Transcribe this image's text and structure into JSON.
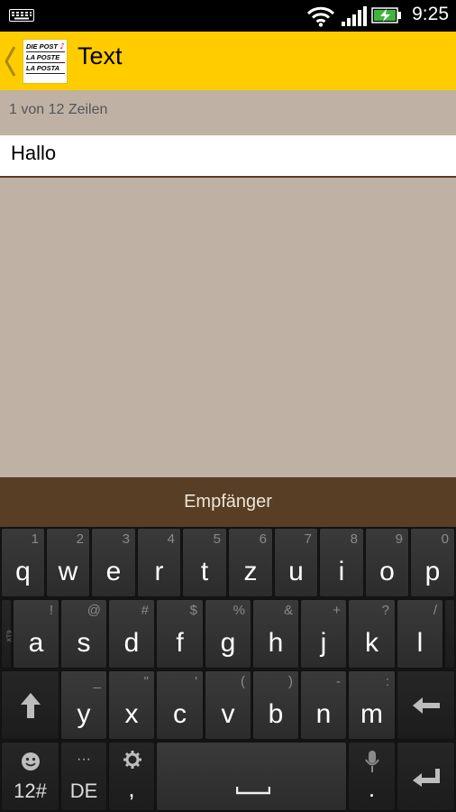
{
  "status_bar": {
    "time": "9:25",
    "icons": [
      "keyboard-icon",
      "wifi-icon",
      "signal-icon",
      "battery-charging-icon"
    ]
  },
  "action_bar": {
    "title": "Text",
    "logo_lines": [
      "DIE POST",
      "LA POSTE",
      "LA POSTA"
    ],
    "brand_color": "#ffcc00"
  },
  "editor": {
    "counter": "1 von 12 Zeilen",
    "line_value": "Hallo"
  },
  "recipient_button": {
    "label": "Empfänger"
  },
  "keyboard": {
    "row1": [
      {
        "key": "q",
        "hint": "1"
      },
      {
        "key": "w",
        "hint": "2"
      },
      {
        "key": "e",
        "hint": "3"
      },
      {
        "key": "r",
        "hint": "4"
      },
      {
        "key": "t",
        "hint": "5"
      },
      {
        "key": "z",
        "hint": "6"
      },
      {
        "key": "u",
        "hint": "7"
      },
      {
        "key": "i",
        "hint": "8"
      },
      {
        "key": "o",
        "hint": "9"
      },
      {
        "key": "p",
        "hint": "0"
      }
    ],
    "row2": [
      {
        "key": "a",
        "hint": "!"
      },
      {
        "key": "s",
        "hint": "@"
      },
      {
        "key": "d",
        "hint": "#"
      },
      {
        "key": "f",
        "hint": "$"
      },
      {
        "key": "g",
        "hint": "%"
      },
      {
        "key": "h",
        "hint": "&"
      },
      {
        "key": "j",
        "hint": "+"
      },
      {
        "key": "k",
        "hint": "?"
      },
      {
        "key": "l",
        "hint": "/"
      }
    ],
    "row3": [
      {
        "key": "y",
        "hint": "_"
      },
      {
        "key": "x",
        "hint": "\""
      },
      {
        "key": "c",
        "hint": "'"
      },
      {
        "key": "v",
        "hint": "("
      },
      {
        "key": "b",
        "hint": ")"
      },
      {
        "key": "n",
        "hint": "-"
      },
      {
        "key": "m",
        "hint": ":"
      }
    ],
    "side_tag": "XT9",
    "symbols_label": "12#",
    "language_label": "DE",
    "language_dots": "···",
    "comma": ",",
    "period": "."
  },
  "colors": {
    "background": "#bfb2a5",
    "recipient_bar": "#573e24",
    "keyboard": "#141414"
  }
}
